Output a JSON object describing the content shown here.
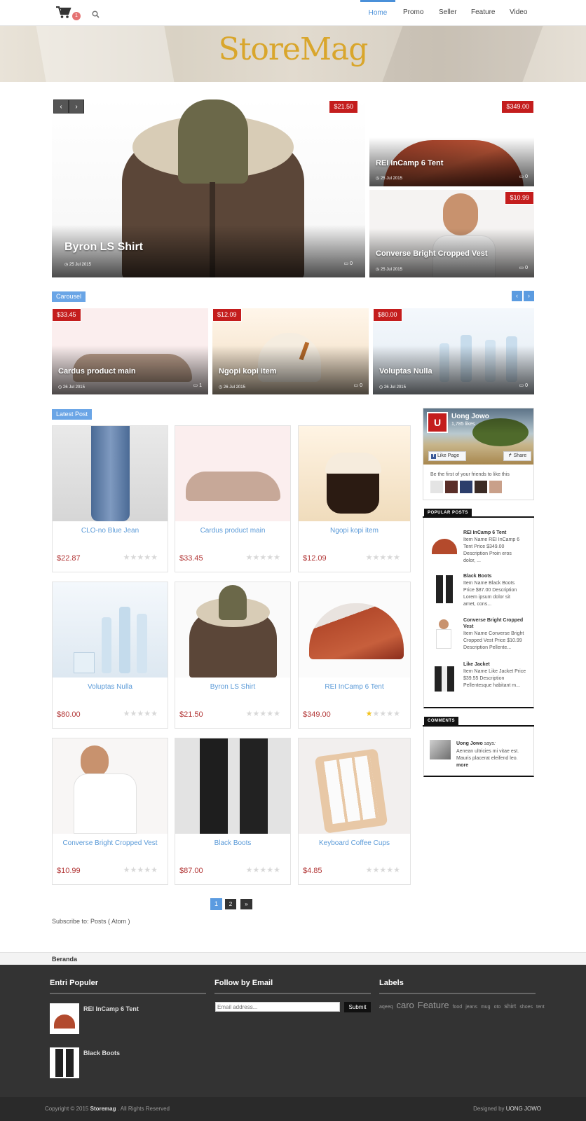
{
  "header": {
    "cart_count": "1",
    "nav": [
      "Home",
      "Promo",
      "Seller",
      "Feature",
      "Video"
    ],
    "logo": "StoreMag"
  },
  "slider": {
    "main": {
      "title": "Byron LS Shirt",
      "price": "$21.50",
      "date": "25 Jul 2015",
      "comments": "0"
    },
    "side1": {
      "title": "REI InCamp 6 Tent",
      "price": "$349.00",
      "date": "25 Jul 2015",
      "comments": "0"
    },
    "side2": {
      "title": "Converse Bright Cropped Vest",
      "price": "$10.99",
      "date": "25 Jul 2015",
      "comments": "0"
    }
  },
  "carousel": {
    "label": "Carousel",
    "items": [
      {
        "title": "Cardus product main",
        "price": "$33.45",
        "date": "26 Jul 2015",
        "comments": "1"
      },
      {
        "title": "Ngopi kopi item",
        "price": "$12.09",
        "date": "26 Jul 2015",
        "comments": "0"
      },
      {
        "title": "Voluptas Nulla",
        "price": "$80.00",
        "date": "26 Jul 2015",
        "comments": "0"
      }
    ]
  },
  "latest": {
    "label": "Latest Post",
    "products": [
      {
        "name": "CLO-no Blue Jean",
        "price": "$22.87",
        "rating": 0
      },
      {
        "name": "Cardus product main",
        "price": "$33.45",
        "rating": 0
      },
      {
        "name": "Ngopi kopi item",
        "price": "$12.09",
        "rating": 0
      },
      {
        "name": "Voluptas Nulla",
        "price": "$80.00",
        "rating": 0
      },
      {
        "name": "Byron LS Shirt",
        "price": "$21.50",
        "rating": 0
      },
      {
        "name": "REI InCamp 6 Tent",
        "price": "$349.00",
        "rating": 1
      },
      {
        "name": "Converse Bright Cropped Vest",
        "price": "$10.99",
        "rating": 0
      },
      {
        "name": "Black Boots",
        "price": "$87.00",
        "rating": 0
      },
      {
        "name": "Keyboard Coffee Cups",
        "price": "$4.85",
        "rating": 0
      }
    ],
    "pages": [
      "1",
      "2",
      "»"
    ],
    "subscribe_prefix": "Subscribe to: ",
    "subscribe_link": "Posts ( Atom )"
  },
  "facebook": {
    "name": "Uong Jowo",
    "likes": "1,785 likes",
    "like_btn": "Like Page",
    "share_btn": "Share",
    "friends_text": "Be the first of your friends to like this"
  },
  "popular": {
    "heading": "POPULAR POSTS",
    "items": [
      {
        "title": "REI InCamp 6 Tent",
        "desc": [
          "Item Name REI InCamp 6",
          "Tent Price $349.00",
          "Description Proin eros",
          "dolor, ..."
        ]
      },
      {
        "title": "Black Boots",
        "desc": [
          "Item Name Black Boots",
          "Price $87.00 Description",
          "Lorem ipsum dolor sit",
          "amet, cons..."
        ]
      },
      {
        "title": "Converse Bright Cropped Vest",
        "desc": [
          "Item Name Converse Bright",
          "Cropped Vest Price $10.99",
          "Description Pellente..."
        ]
      },
      {
        "title": "Like Jacket",
        "desc": [
          "Item Name Like Jacket Price",
          "$39.55 Description",
          "Pellentesque habitant m..."
        ]
      }
    ]
  },
  "comments": {
    "heading": "COMMENTS",
    "author": "Uong Jowo",
    "says": " says:",
    "text": [
      "Aenean ultricies mi vitae est.",
      "Mauris placerat eleifend leo."
    ],
    "more": "more"
  },
  "footer": {
    "breadcrumb": "Beranda",
    "entri_heading": "Entri Populer",
    "entri": [
      "REI InCamp 6 Tent",
      "Black Boots"
    ],
    "follow_heading": "Follow by Email",
    "email_placeholder": "Email address...",
    "submit": "Submit",
    "labels_heading": "Labels",
    "labels": [
      {
        "text": "aqeeq",
        "size": "small"
      },
      {
        "text": "caro",
        "size": "large"
      },
      {
        "text": "Feature",
        "size": "large"
      },
      {
        "text": "food",
        "size": "small"
      },
      {
        "text": "jeans",
        "size": "small"
      },
      {
        "text": "mug",
        "size": "small"
      },
      {
        "text": "oto",
        "size": "small"
      },
      {
        "text": "shirt",
        "size": "medium"
      },
      {
        "text": "shoes",
        "size": "small"
      },
      {
        "text": "tent",
        "size": "small"
      }
    ],
    "copyright_prefix": "Copyright © 2015 ",
    "copyright_brand": "Storemag",
    "copyright_suffix": " . All Rights Reserved",
    "designed_prefix": "Designed by ",
    "designed_by": "UONG JOWO"
  },
  "colors": {
    "accent": "#4a90d9",
    "price_badge": "#c41d1d",
    "footer": "#333333"
  }
}
